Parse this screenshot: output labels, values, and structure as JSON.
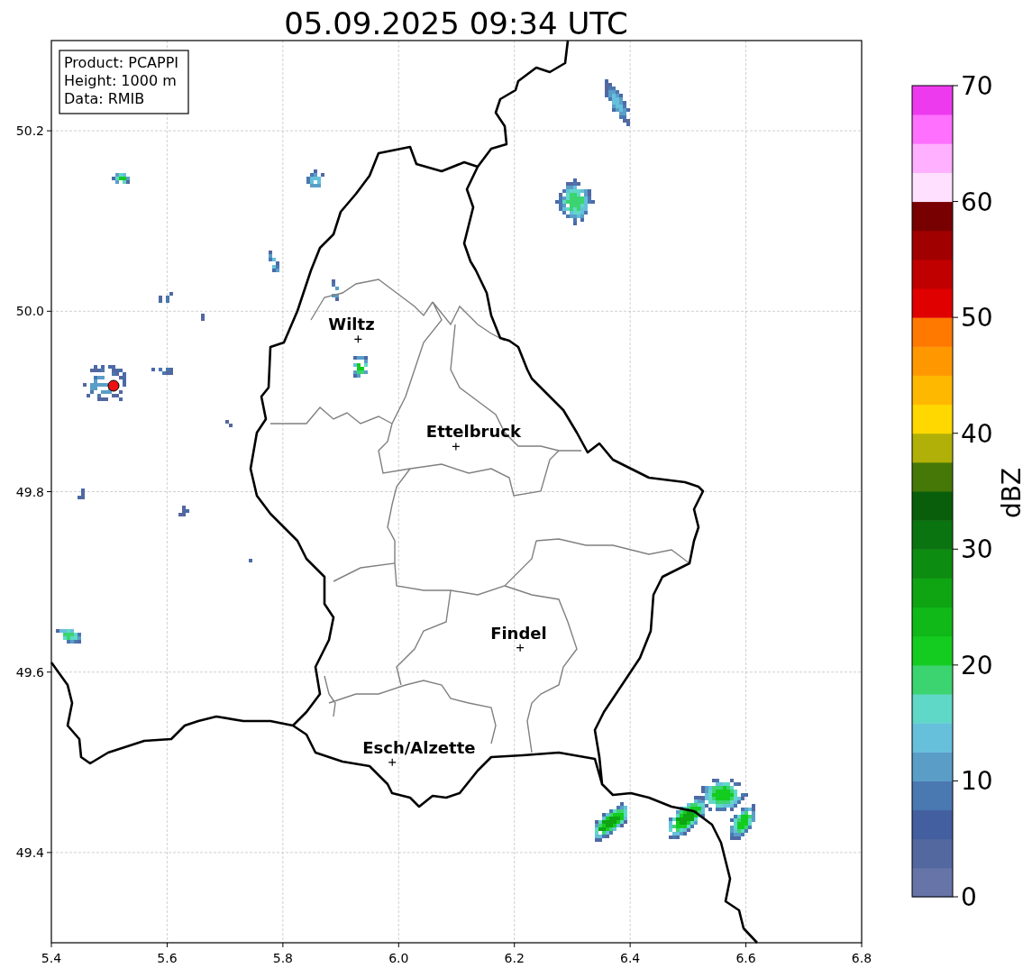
{
  "title": "05.09.2025 09:34 UTC",
  "info_box": [
    "Product: PCAPPI",
    "Height: 1000 m",
    "Data: RMIB"
  ],
  "map": {
    "x_ticks": [
      "5.4",
      "5.6",
      "5.8",
      "6.0",
      "6.2",
      "6.4",
      "6.6",
      "6.8"
    ],
    "y_ticks": [
      "50.2",
      "50.0",
      "49.8",
      "49.6",
      "49.4"
    ],
    "cities": [
      {
        "name": "Wiltz"
      },
      {
        "name": "Ettelbruck"
      },
      {
        "name": "Findel"
      },
      {
        "name": "Esch/Alzette"
      }
    ]
  },
  "colorbar": {
    "label": "dBZ",
    "ticks": [
      "70",
      "60",
      "50",
      "40",
      "30",
      "20",
      "10",
      "0"
    ],
    "segments": [
      {
        "color": "#6674a8"
      },
      {
        "color": "#5468a0"
      },
      {
        "color": "#445fa0"
      },
      {
        "color": "#4a78b0"
      },
      {
        "color": "#5a9ec8"
      },
      {
        "color": "#66c0dc"
      },
      {
        "color": "#60d8c8"
      },
      {
        "color": "#3cd470"
      },
      {
        "color": "#14cc20"
      },
      {
        "color": "#10b818"
      },
      {
        "color": "#0ea412"
      },
      {
        "color": "#0c8c10"
      },
      {
        "color": "#0a7410"
      },
      {
        "color": "#085e0a"
      },
      {
        "color": "#467808"
      },
      {
        "color": "#b0b008"
      },
      {
        "color": "#ffd800"
      },
      {
        "color": "#ffb800"
      },
      {
        "color": "#ff9800"
      },
      {
        "color": "#ff7800"
      },
      {
        "color": "#e00000"
      },
      {
        "color": "#c00000"
      },
      {
        "color": "#a00000"
      },
      {
        "color": "#780000"
      },
      {
        "color": "#ffe0ff"
      },
      {
        "color": "#ffb0ff"
      },
      {
        "color": "#ff70ff"
      },
      {
        "color": "#ee3aee"
      }
    ]
  }
}
